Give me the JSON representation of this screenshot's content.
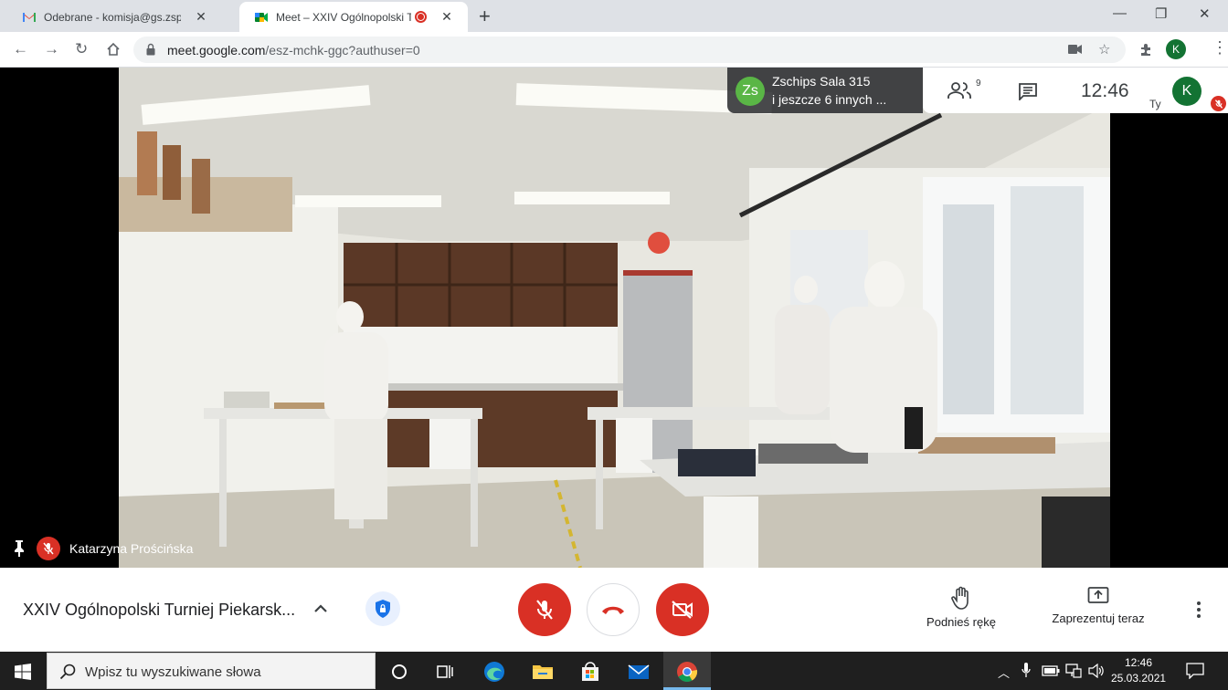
{
  "browser": {
    "tabs": [
      {
        "title": "Odebrane - komisja@gs.zsps.poz",
        "icon": "gmail-icon",
        "active": false
      },
      {
        "title": "Meet – XXIV Ogólnopolski Tu",
        "icon": "meet-icon",
        "active": true,
        "recording": true
      }
    ],
    "new_tab_label": "+",
    "url_host": "meet.google.com",
    "url_path": "/esz-mchk-ggc?authuser=0",
    "profile_initial": "K",
    "colors": {
      "tabstrip": "#dee1e6",
      "profile": "#137333"
    }
  },
  "meeting": {
    "speaker_name": "Katarzyna Prościńska",
    "presenter_line1": "Zschips Sala 315",
    "presenter_line2": "i jeszcze 6 innych ...",
    "presenter_initials": "Zs",
    "people_count": "9",
    "clock": "12:46",
    "self_initial": "K",
    "self_label": "Ty",
    "title": "XXIV Ogólnopolski Turniej Piekarsk...",
    "raise_hand_label": "Podnieś rękę",
    "present_label": "Zaprezentuj teraz",
    "colors": {
      "danger": "#d93025",
      "presenter_avatar": "#5ab646"
    }
  },
  "taskbar": {
    "search_placeholder": "Wpisz tu wyszukiwane słowa",
    "time": "12:46",
    "date": "25.03.2021",
    "icons": [
      "windows-start-icon",
      "cortana-icon",
      "task-view-icon",
      "edge-icon",
      "file-explorer-icon",
      "store-icon",
      "mail-icon",
      "chrome-icon"
    ]
  }
}
